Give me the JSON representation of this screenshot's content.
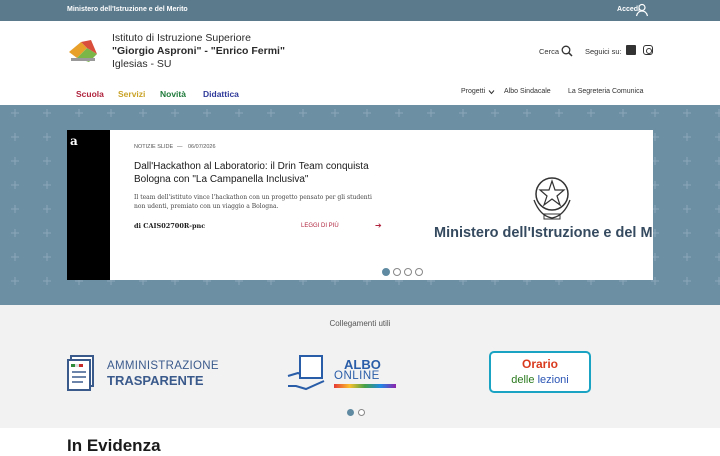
{
  "topbar": {
    "ministry": "Ministero dell'Istruzione e del Merito",
    "login": "Accedi"
  },
  "header": {
    "line1": "Istituto di Istruzione Superiore",
    "line2": "\"Giorgio Asproni\" - \"Enrico Fermi\"",
    "line3": "Iglesias - SU",
    "search": "Cerca",
    "follow": "Seguici su:"
  },
  "nav": {
    "items": [
      {
        "label": "Scuola",
        "color": "#b0243e"
      },
      {
        "label": "Servizi",
        "color": "#c9a227"
      },
      {
        "label": "Novità",
        "color": "#1f7a3a"
      },
      {
        "label": "Didattica",
        "color": "#2f3a9a"
      }
    ],
    "right": [
      "Progetti",
      "Albo Sindacale",
      "La Segreteria Comunica"
    ]
  },
  "slide": {
    "category": "NOTIZIE SLIDE",
    "date": "06/07/2026",
    "title": "Dall'Hackathon al Laboratorio: il Drin Team conquista Bologna con \"La Campanella Inclusiva\"",
    "description": "Il team dell'istituto vince l'hackathon con un progetto pensato per gli studenti non udenti, premiato con un viaggio a Bologna.",
    "author": "di CAIS02700R-pnc",
    "readmore": "LEGGI DI PIÙ",
    "image_text": "Ministero dell'Istruzione e del Merito",
    "image_letter": "a",
    "active_dot": 0,
    "dot_count": 4
  },
  "useful": {
    "title": "Collegamenti utili",
    "amm1": "AMMINISTRAZIONE",
    "amm2": "TRASPARENTE",
    "albo1": "ALBO",
    "albo2": "ONLINE",
    "orario1": "Orario",
    "orario2a": "delle",
    "orario2b": "lezioni",
    "dot_count": 2,
    "active_dot": 0
  },
  "evidenza": "In Evidenza"
}
